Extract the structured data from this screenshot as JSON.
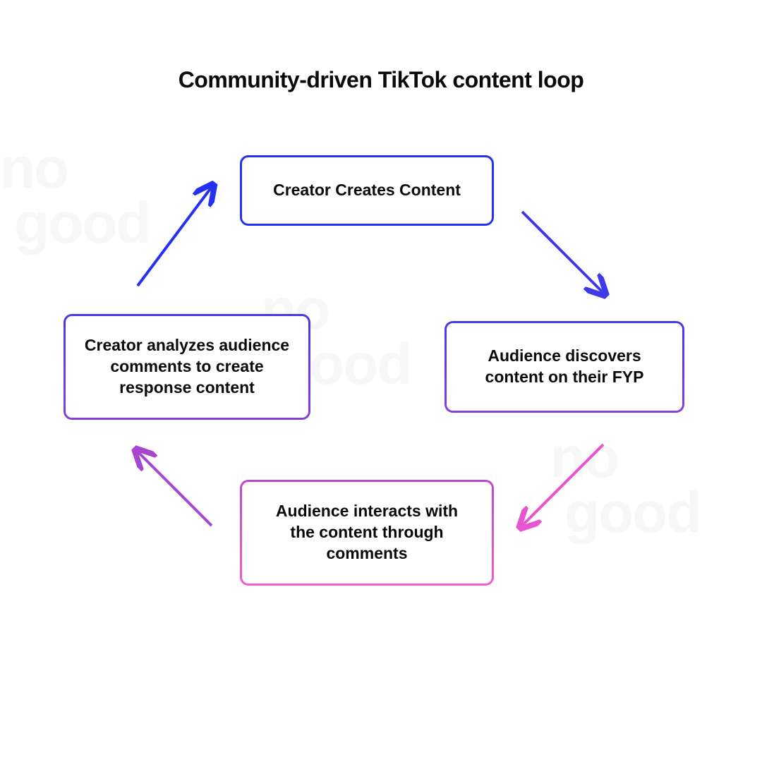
{
  "title": "Community-driven TikTok content loop",
  "watermark": {
    "line1": "no",
    "line2": "good"
  },
  "boxes": {
    "top": "Creator Creates Content",
    "right": "Audience discovers content on their FYP",
    "bottom": "Audience interacts with the content through comments",
    "left": "Creator analyzes audience comments to create response content"
  },
  "colors": {
    "blue": "#2431f0",
    "purple": "#8740d9",
    "pink": "#e755d0"
  }
}
